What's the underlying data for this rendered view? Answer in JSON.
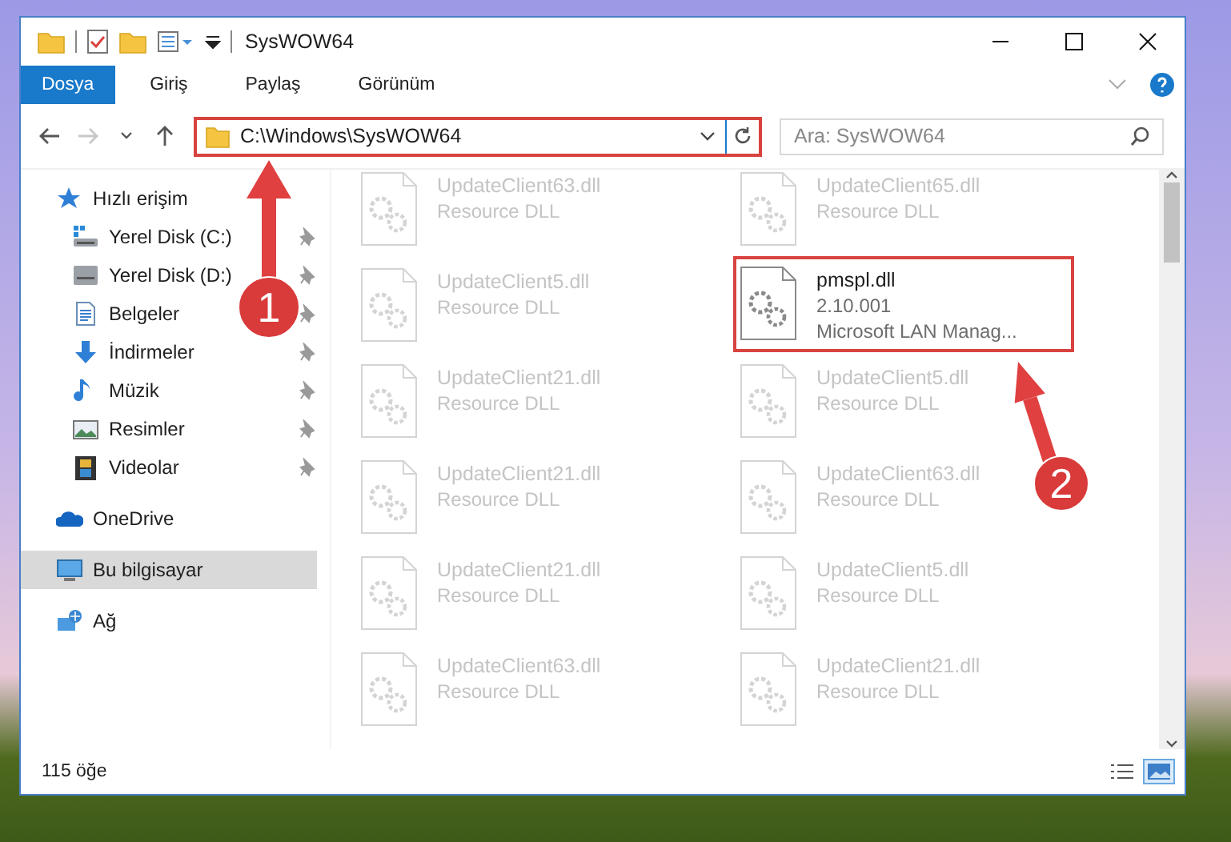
{
  "window": {
    "title": "SysWOW64"
  },
  "ribbon_tabs": [
    {
      "label": "Dosya",
      "selected": true
    },
    {
      "label": "Giriş",
      "selected": false
    },
    {
      "label": "Paylaş",
      "selected": false
    },
    {
      "label": "Görünüm",
      "selected": false
    }
  ],
  "address_bar": {
    "path": "C:\\Windows\\SysWOW64"
  },
  "search": {
    "placeholder": "Ara: SysWOW64"
  },
  "sidebar": {
    "items": [
      {
        "label": "Hızlı erişim",
        "kind": "star",
        "selected": false,
        "children": [
          {
            "label": "Yerel Disk (C:)",
            "kind": "system-drive",
            "pinned": true,
            "selected": false
          },
          {
            "label": "Yerel Disk (D:)",
            "kind": "drive",
            "pinned": true,
            "selected": false
          },
          {
            "label": "Belgeler",
            "kind": "documents",
            "pinned": true,
            "selected": false
          },
          {
            "label": "İndirmeler",
            "kind": "downloads",
            "pinned": true,
            "selected": false
          },
          {
            "label": "Müzik",
            "kind": "music",
            "pinned": true,
            "selected": false
          },
          {
            "label": "Resimler",
            "kind": "pictures",
            "pinned": true,
            "selected": false
          },
          {
            "label": "Videolar",
            "kind": "videos",
            "pinned": true,
            "selected": false
          }
        ]
      },
      {
        "label": "OneDrive",
        "kind": "cloud",
        "selected": false
      },
      {
        "label": "Bu bilgisayar",
        "kind": "computer",
        "selected": true
      },
      {
        "label": "Ağ",
        "kind": "network",
        "selected": false
      }
    ]
  },
  "files": [
    {
      "name": "UpdateClient63.dll",
      "details": [
        "Resource DLL"
      ],
      "faded": true
    },
    {
      "name": "UpdateClient65.dll",
      "details": [
        "Resource DLL"
      ],
      "faded": true
    },
    {
      "name": "UpdateClient5.dll",
      "details": [
        "Resource DLL"
      ],
      "faded": true
    },
    {
      "name": "pmspl.dll",
      "details": [
        "2.10.001",
        "Microsoft LAN Manag..."
      ],
      "faded": false,
      "highlighted": true
    },
    {
      "name": "UpdateClient21.dll",
      "details": [
        "Resource DLL"
      ],
      "faded": true
    },
    {
      "name": "UpdateClient5.dll",
      "details": [
        "Resource DLL"
      ],
      "faded": true
    },
    {
      "name": "UpdateClient21.dll",
      "details": [
        "Resource DLL"
      ],
      "faded": true
    },
    {
      "name": "UpdateClient63.dll",
      "details": [
        "Resource DLL"
      ],
      "faded": true
    },
    {
      "name": "UpdateClient21.dll",
      "details": [
        "Resource DLL"
      ],
      "faded": true
    },
    {
      "name": "UpdateClient5.dll",
      "details": [
        "Resource DLL"
      ],
      "faded": true
    },
    {
      "name": "UpdateClient63.dll",
      "details": [
        "Resource DLL"
      ],
      "faded": true
    },
    {
      "name": "UpdateClient21.dll",
      "details": [
        "Resource DLL"
      ],
      "faded": true
    }
  ],
  "status_bar": {
    "item_count": "115 öğe",
    "view_buttons": [
      {
        "kind": "details",
        "selected": false
      },
      {
        "kind": "large-icons",
        "selected": true
      }
    ]
  },
  "annotations": [
    {
      "label": "1"
    },
    {
      "label": "2"
    }
  ]
}
